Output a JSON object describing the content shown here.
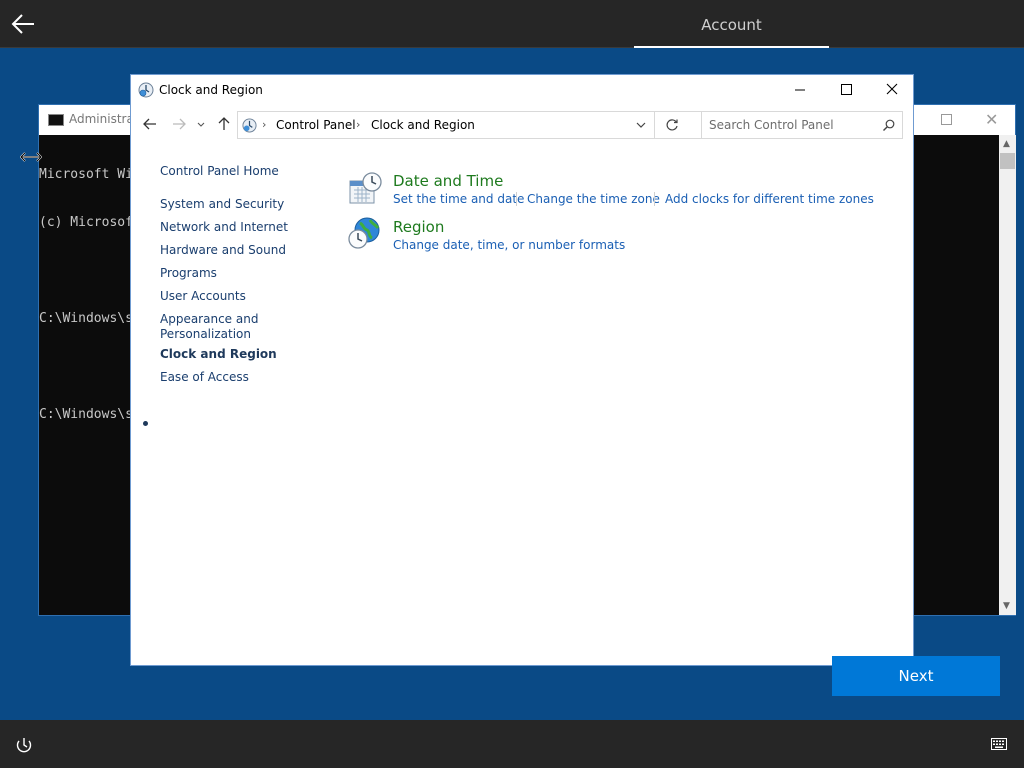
{
  "oobe": {
    "tab_label": "Account",
    "next_label": "Next"
  },
  "cmd": {
    "title": "Administrat",
    "lines": [
      "Microsoft Wi",
      "(c) Microsof",
      "",
      "C:\\Windows\\s",
      "",
      "C:\\Windows\\s"
    ]
  },
  "window": {
    "title": "Clock and Region",
    "address": {
      "crumbs": [
        "Control Panel",
        "Clock and Region"
      ]
    },
    "search": {
      "placeholder": "Search Control Panel"
    },
    "sidebar": {
      "home": "Control Panel Home",
      "items": [
        {
          "label": "System and Security"
        },
        {
          "label": "Network and Internet"
        },
        {
          "label": "Hardware and Sound"
        },
        {
          "label": "Programs"
        },
        {
          "label": "User Accounts"
        },
        {
          "label": "Appearance and Personalization"
        },
        {
          "label": "Clock and Region",
          "current": true
        },
        {
          "label": "Ease of Access"
        }
      ]
    },
    "categories": [
      {
        "title": "Date and Time",
        "icon": "calendar-clock-icon",
        "tasks": [
          "Set the time and date",
          "Change the time zone",
          "Add clocks for different time zones"
        ]
      },
      {
        "title": "Region",
        "icon": "globe-clock-icon",
        "tasks": [
          "Change date, time, or number formats"
        ]
      }
    ]
  },
  "colors": {
    "desktop": "#0a4a86",
    "accent": "#0078d7",
    "category_title": "#1e7a1e",
    "task_link": "#1a5fb4"
  }
}
